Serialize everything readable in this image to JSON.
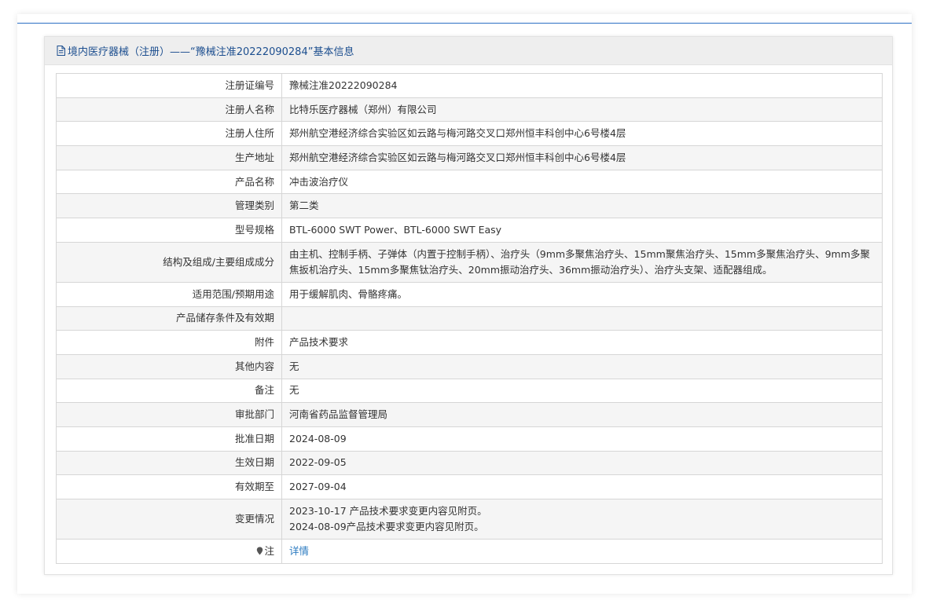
{
  "header": {
    "title": "境内医疗器械（注册）——“豫械注准20222090284”基本信息",
    "icon": "document-icon"
  },
  "rows": [
    {
      "label": "注册证编号",
      "value": "豫械注准20222090284"
    },
    {
      "label": "注册人名称",
      "value": "比特乐医疗器械（郑州）有限公司"
    },
    {
      "label": "注册人住所",
      "value": "郑州航空港经济综合实验区如云路与梅河路交叉口郑州恒丰科创中心6号楼4层"
    },
    {
      "label": "生产地址",
      "value": "郑州航空港经济综合实验区如云路与梅河路交叉口郑州恒丰科创中心6号楼4层"
    },
    {
      "label": "产品名称",
      "value": "冲击波治疗仪"
    },
    {
      "label": "管理类别",
      "value": "第二类"
    },
    {
      "label": "型号规格",
      "value": "BTL-6000 SWT Power、BTL-6000 SWT Easy"
    },
    {
      "label": "结构及组成/主要组成成分",
      "value": "由主机、控制手柄、子弹体（内置于控制手柄）、治疗头（9mm多聚焦治疗头、15mm聚焦治疗头、15mm多聚焦治疗头、9mm多聚焦扳机治疗头、15mm多聚焦钛治疗头、20mm振动治疗头、36mm振动治疗头）、治疗头支架、适配器组成。"
    },
    {
      "label": "适用范围/预期用途",
      "value": "用于缓解肌肉、骨骼疼痛。"
    },
    {
      "label": "产品储存条件及有效期",
      "value": ""
    },
    {
      "label": "附件",
      "value": "产品技术要求"
    },
    {
      "label": "其他内容",
      "value": "无"
    },
    {
      "label": "备注",
      "value": "无"
    },
    {
      "label": "审批部门",
      "value": "河南省药品监督管理局"
    },
    {
      "label": "批准日期",
      "value": "2024-08-09"
    },
    {
      "label": "生效日期",
      "value": "2022-09-05"
    },
    {
      "label": "有效期至",
      "value": "2027-09-04"
    },
    {
      "label": "变更情况",
      "value_lines": [
        "2023-10-17 产品技术要求变更内容见附页。",
        "2024-08-09产品技术要求变更内容见附页。"
      ]
    },
    {
      "label": "注",
      "icon": "pin-icon",
      "link": "详情"
    }
  ],
  "colors": {
    "accent_line": "#2c6fc4",
    "header_text": "#1c4e8f",
    "link": "#2a7ac0"
  }
}
